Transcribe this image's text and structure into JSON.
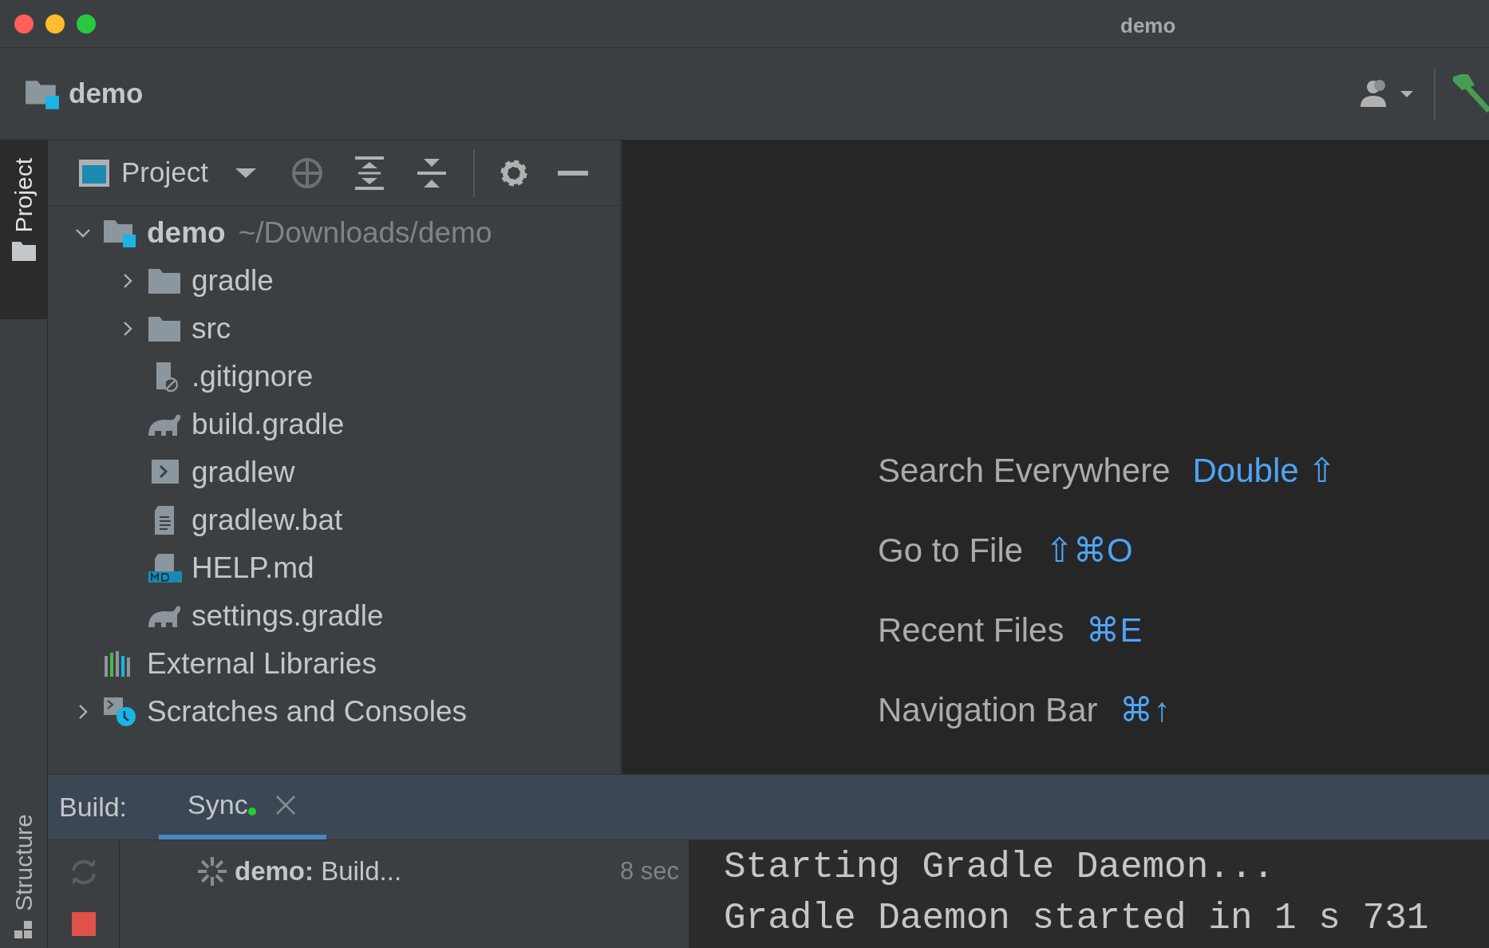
{
  "window": {
    "title": "demo"
  },
  "navbar": {
    "project": "demo"
  },
  "left_stripe": {
    "top_tabs": [
      {
        "label": "Project",
        "selected": true
      }
    ],
    "bottom_tabs": [
      {
        "label": "Structure",
        "selected": false
      }
    ]
  },
  "project_panel": {
    "view": "Project",
    "tree": [
      {
        "label": "demo",
        "path": "~/Downloads/demo",
        "kind": "module",
        "expanded": true,
        "children": [
          {
            "label": "gradle",
            "kind": "folder",
            "expanded": false
          },
          {
            "label": "src",
            "kind": "folder",
            "expanded": false
          },
          {
            "label": ".gitignore",
            "kind": "ignore"
          },
          {
            "label": "build.gradle",
            "kind": "gradle"
          },
          {
            "label": "gradlew",
            "kind": "script"
          },
          {
            "label": "gradlew.bat",
            "kind": "text"
          },
          {
            "label": "HELP.md",
            "kind": "markdown"
          },
          {
            "label": "settings.gradle",
            "kind": "gradle"
          }
        ]
      },
      {
        "label": "External Libraries",
        "kind": "libraries"
      },
      {
        "label": "Scratches and Consoles",
        "kind": "scratches",
        "expanded": false
      }
    ]
  },
  "editor_hints": [
    {
      "label": "Search Everywhere",
      "shortcut": "Double ⇧"
    },
    {
      "label": "Go to File",
      "shortcut": "⇧⌘O"
    },
    {
      "label": "Recent Files",
      "shortcut": "⌘E"
    },
    {
      "label": "Navigation Bar",
      "shortcut": "⌘↑"
    }
  ],
  "build": {
    "title": "Build:",
    "tabs": [
      {
        "label": "Sync",
        "selected": true,
        "running": true
      }
    ],
    "tasks": [
      {
        "project": "demo:",
        "text": "Build...",
        "time": "8 sec"
      }
    ],
    "console": [
      "Starting Gradle Daemon...",
      "Gradle Daemon started in 1 s 731"
    ]
  }
}
